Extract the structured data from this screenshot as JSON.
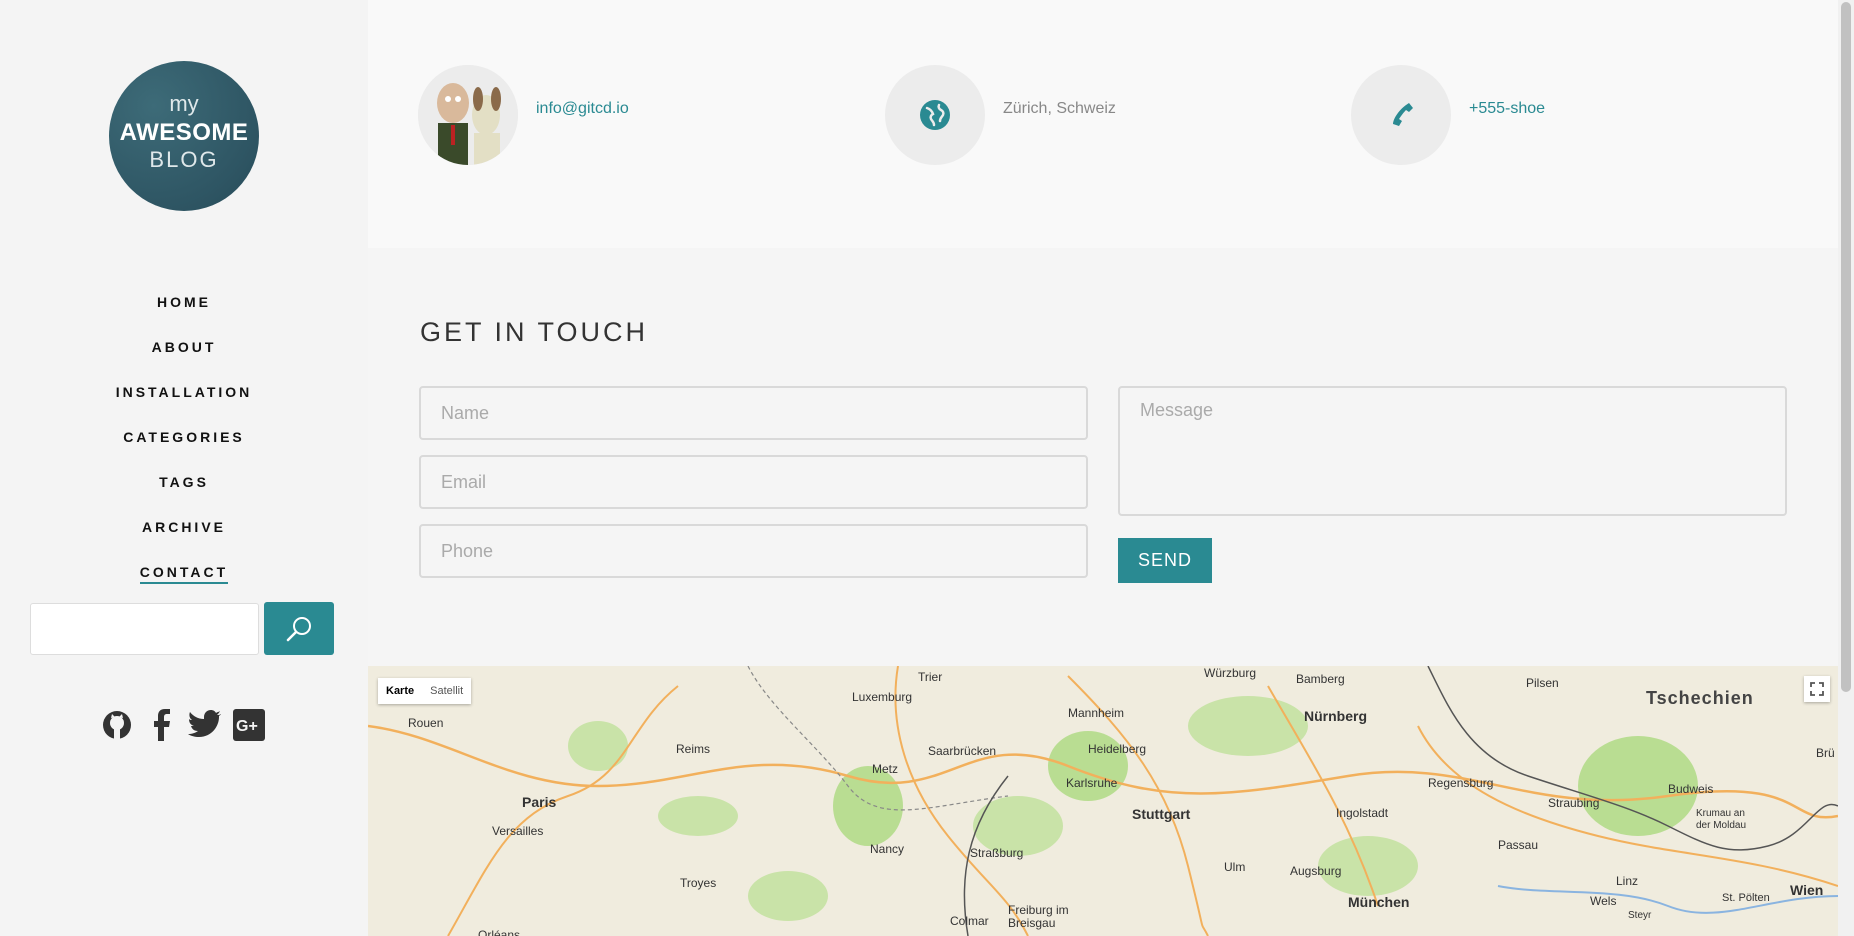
{
  "logo": {
    "line1": "my",
    "line2": "AWESOME",
    "line3": "BLOG"
  },
  "nav": [
    {
      "label": "HOME"
    },
    {
      "label": "ABOUT"
    },
    {
      "label": "INSTALLATION"
    },
    {
      "label": "CATEGORIES"
    },
    {
      "label": "TAGS"
    },
    {
      "label": "ARCHIVE"
    },
    {
      "label": "CONTACT",
      "active": true
    }
  ],
  "search": {
    "placeholder": "",
    "icon": "search-icon"
  },
  "social": [
    "github-icon",
    "facebook-icon",
    "twitter-icon",
    "google-plus-icon"
  ],
  "contact_info": {
    "email": "info@gitcd.io",
    "location": "Zürich, Schweiz",
    "phone": "+555-shoe"
  },
  "form": {
    "title": "GET IN TOUCH",
    "name_placeholder": "Name",
    "email_placeholder": "Email",
    "phone_placeholder": "Phone",
    "message_placeholder": "Message",
    "send_label": "SEND"
  },
  "map": {
    "toggle_map": "Karte",
    "toggle_satellite": "Satellit",
    "labels": [
      "Würzburg",
      "Bamberg",
      "Pilsen",
      "Tschechien",
      "Trier",
      "Luxemburg",
      "Mannheim",
      "Nürnberg",
      "Rouen",
      "Reims",
      "Heidelberg",
      "Saarbrücken",
      "Paris",
      "Metz",
      "Karlsruhe",
      "Regensburg",
      "Budweis",
      "Straubing",
      "Ingolstadt",
      "Stuttgart",
      "Versailles",
      "Nancy",
      "Straßburg",
      "Passau",
      "Krumau an der Moldau",
      "Ulm",
      "Augsburg",
      "Troyes",
      "Linz",
      "Wien",
      "Colmar",
      "Freiburg im Breisgau",
      "München",
      "Wels",
      "Steyr",
      "St. Pölten",
      "Orléans",
      "Brü"
    ]
  },
  "colors": {
    "accent": "#2a8a92",
    "logo": "#2e5563"
  }
}
